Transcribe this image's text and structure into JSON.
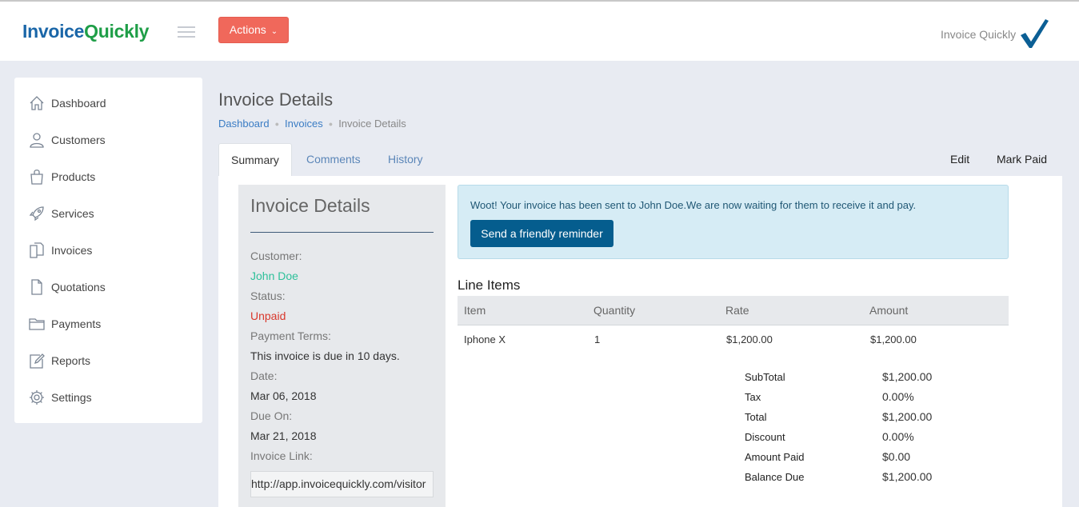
{
  "header": {
    "logo_part1": "Invoice",
    "logo_part2": "Quickly",
    "actions_label": "Actions",
    "brand_right": "Invoice Quickly",
    "brand_color": "#1a66a8",
    "accent_color": "#f0685b"
  },
  "sidebar": {
    "items": [
      {
        "label": "Dashboard",
        "icon": "home-icon"
      },
      {
        "label": "Customers",
        "icon": "user-icon"
      },
      {
        "label": "Products",
        "icon": "shopping-bag-icon"
      },
      {
        "label": "Services",
        "icon": "rocket-icon"
      },
      {
        "label": "Invoices",
        "icon": "documents-icon"
      },
      {
        "label": "Quotations",
        "icon": "document-icon"
      },
      {
        "label": "Payments",
        "icon": "wallet-icon"
      },
      {
        "label": "Reports",
        "icon": "edit-icon"
      },
      {
        "label": "Settings",
        "icon": "gear-icon"
      }
    ]
  },
  "main": {
    "title": "Invoice Details",
    "breadcrumb": [
      "Dashboard",
      "Invoices",
      "Invoice Details"
    ],
    "tabs": [
      "Summary",
      "Comments",
      "History"
    ],
    "active_tab": "Summary",
    "actions": [
      "Edit",
      "Mark Paid"
    ]
  },
  "details": {
    "heading": "Invoice Details",
    "customer_label": "Customer:",
    "customer": "John Doe",
    "status_label": "Status:",
    "status": "Unpaid",
    "terms_label": "Payment Terms:",
    "terms": "This invoice is due in 10 days.",
    "date_label": "Date:",
    "date": "Mar 06, 2018",
    "due_label": "Due On:",
    "due": "Mar 21, 2018",
    "link_label": "Invoice Link:",
    "link": "http://app.invoicequickly.com/visitor"
  },
  "alert": {
    "message": "Woot! Your invoice has been sent to John Doe.We are now waiting for them to receive it and pay.",
    "button": "Send a friendly reminder"
  },
  "line_items": {
    "title": "Line Items",
    "columns": [
      "Item",
      "Quantity",
      "Rate",
      "Amount"
    ],
    "rows": [
      [
        "Iphone X",
        "1",
        "$1,200.00",
        "$1,200.00"
      ]
    ]
  },
  "totals": [
    {
      "label": "SubTotal",
      "value": "$1,200.00"
    },
    {
      "label": "Tax",
      "value": "0.00%"
    },
    {
      "label": "Total",
      "value": "$1,200.00"
    },
    {
      "label": "Discount",
      "value": "0.00%"
    },
    {
      "label": "Amount Paid",
      "value": "$0.00"
    },
    {
      "label": "Balance Due",
      "value": "$1,200.00"
    }
  ]
}
